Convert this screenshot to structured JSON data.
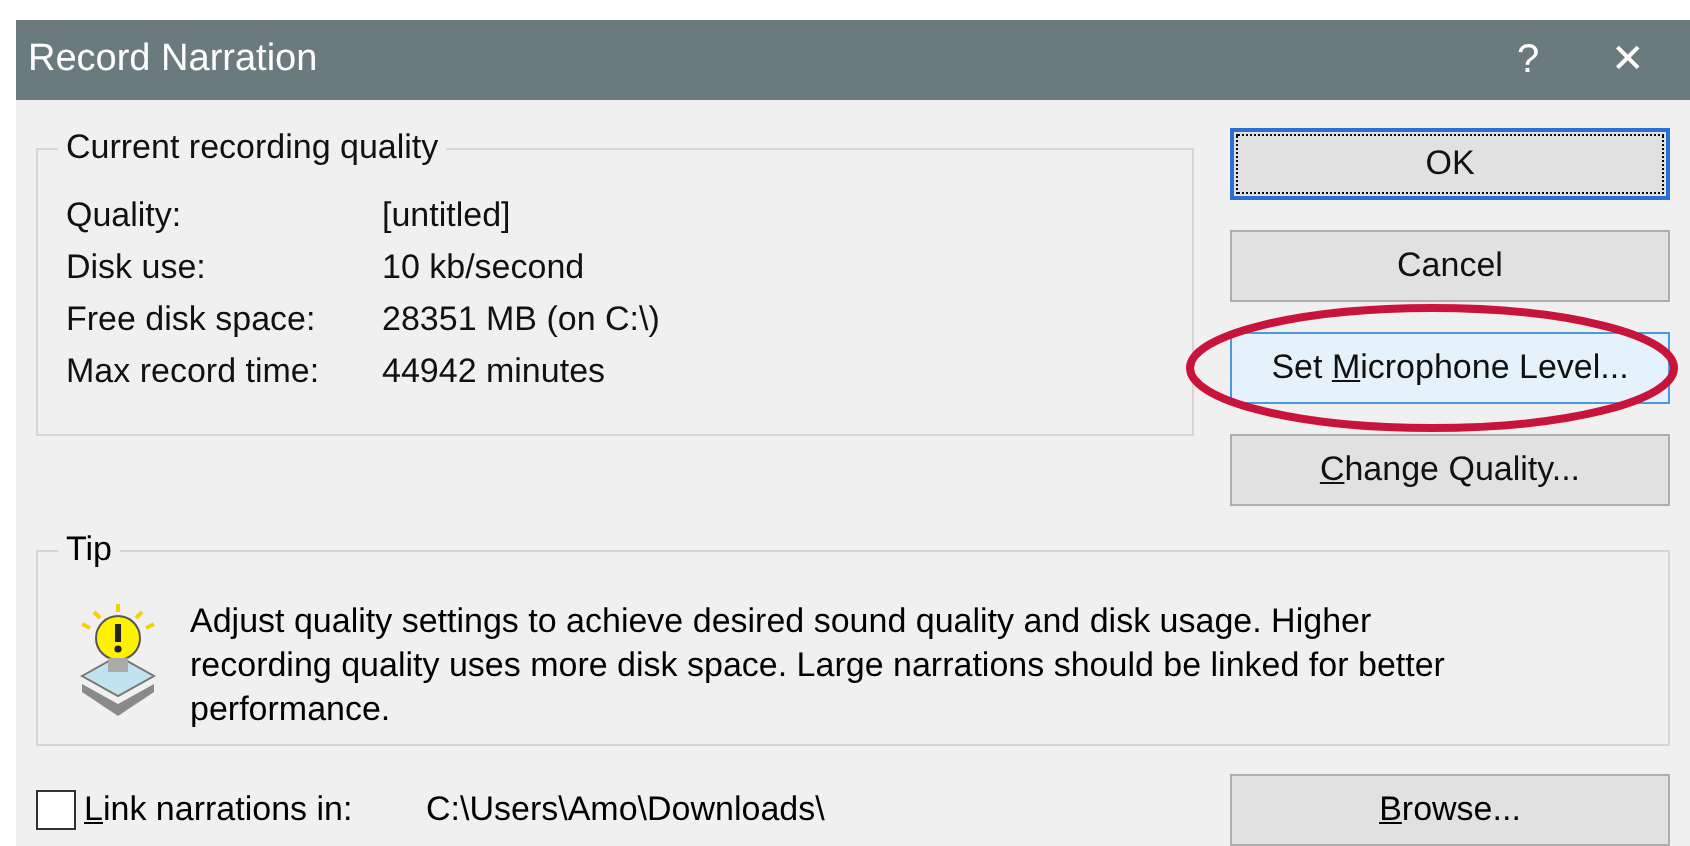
{
  "window": {
    "title": "Record Narration",
    "help": "?",
    "close": "✕"
  },
  "quality_group": {
    "title": "Current recording quality",
    "rows": [
      {
        "label": "Quality:",
        "value": "[untitled]"
      },
      {
        "label": "Disk use:",
        "value": "10 kb/second"
      },
      {
        "label": "Free disk space:",
        "value": "28351 MB (on C:\\)"
      },
      {
        "label": "Max record time:",
        "value": "44942 minutes"
      }
    ]
  },
  "buttons": [
    {
      "label": {
        "after": "OK"
      },
      "default": true,
      "highlighted": false
    },
    {
      "label": {
        "after": "Cancel"
      },
      "default": false,
      "highlighted": false
    },
    {
      "label": {
        "before": "Set ",
        "access_key": "M",
        "after": "icrophone Level..."
      },
      "default": false,
      "highlighted": true
    },
    {
      "label": {
        "access_key": "C",
        "after": "hange Quality..."
      },
      "default": false,
      "highlighted": false
    }
  ],
  "tip": {
    "title": "Tip",
    "text": "Adjust quality settings to achieve desired sound quality and disk usage. Higher recording quality uses more disk space. Large narrations should be linked for better performance."
  },
  "link": {
    "label": {
      "access_key": "L",
      "after": "ink narrations in:"
    },
    "checked": false,
    "path": "C:\\Users\\Amo\\Downloads\\"
  },
  "browse_button": {
    "label": {
      "access_key": "B",
      "after": "rowse..."
    }
  }
}
